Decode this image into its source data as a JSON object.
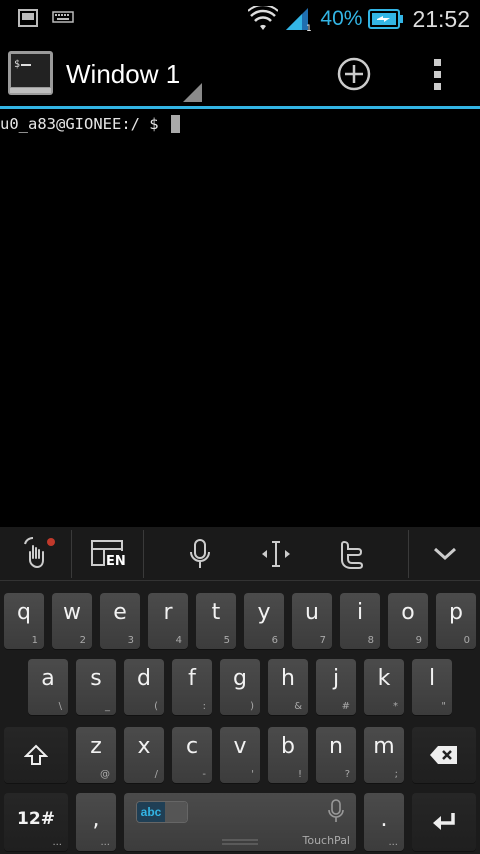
{
  "status_bar": {
    "battery_percent": "40%",
    "time": "21:52",
    "icons": [
      "screenshot-icon",
      "keyboard-icon",
      "wifi-icon",
      "signal-icon",
      "battery-charging-icon"
    ]
  },
  "action_bar": {
    "title": "Window 1",
    "icons": [
      "terminal-app-icon",
      "add-window-icon",
      "overflow-menu-icon"
    ]
  },
  "terminal": {
    "prompt": "u0_a83@GIONEE:/ $"
  },
  "kb_toolbar": {
    "icons": [
      "gesture-icon",
      "layout-en-icon",
      "microphone-icon",
      "cursor-move-icon",
      "twitter-icon",
      "collapse-keyboard-icon"
    ],
    "layout_label": "EN"
  },
  "keyboard": {
    "row1": [
      {
        "main": "q",
        "sub": "1"
      },
      {
        "main": "w",
        "sub": "2"
      },
      {
        "main": "e",
        "sub": "3"
      },
      {
        "main": "r",
        "sub": "4"
      },
      {
        "main": "t",
        "sub": "5"
      },
      {
        "main": "y",
        "sub": "6"
      },
      {
        "main": "u",
        "sub": "7"
      },
      {
        "main": "i",
        "sub": "8"
      },
      {
        "main": "o",
        "sub": "9"
      },
      {
        "main": "p",
        "sub": "0"
      }
    ],
    "row2": [
      {
        "main": "a",
        "sub": "\\"
      },
      {
        "main": "s",
        "sub": "_"
      },
      {
        "main": "d",
        "sub": "("
      },
      {
        "main": "f",
        "sub": ":"
      },
      {
        "main": "g",
        "sub": ")"
      },
      {
        "main": "h",
        "sub": "&"
      },
      {
        "main": "j",
        "sub": "#"
      },
      {
        "main": "k",
        "sub": "*"
      },
      {
        "main": "l",
        "sub": "\""
      }
    ],
    "row3": [
      {
        "main": "z",
        "sub": "@"
      },
      {
        "main": "x",
        "sub": "/"
      },
      {
        "main": "c",
        "sub": "-"
      },
      {
        "main": "v",
        "sub": "'"
      },
      {
        "main": "b",
        "sub": "!"
      },
      {
        "main": "n",
        "sub": "?"
      },
      {
        "main": "m",
        "sub": ";"
      }
    ],
    "symbols_label": "12#",
    "comma_label": ",",
    "period_label": ".",
    "space_brand": "TouchPal",
    "abc_label": "abc",
    "dots": "..."
  },
  "colors": {
    "accent": "#33b5e5",
    "toolbar_bg": "#1a1a1a",
    "key_bg": "#444444",
    "notification_dot": "#c0392b"
  }
}
